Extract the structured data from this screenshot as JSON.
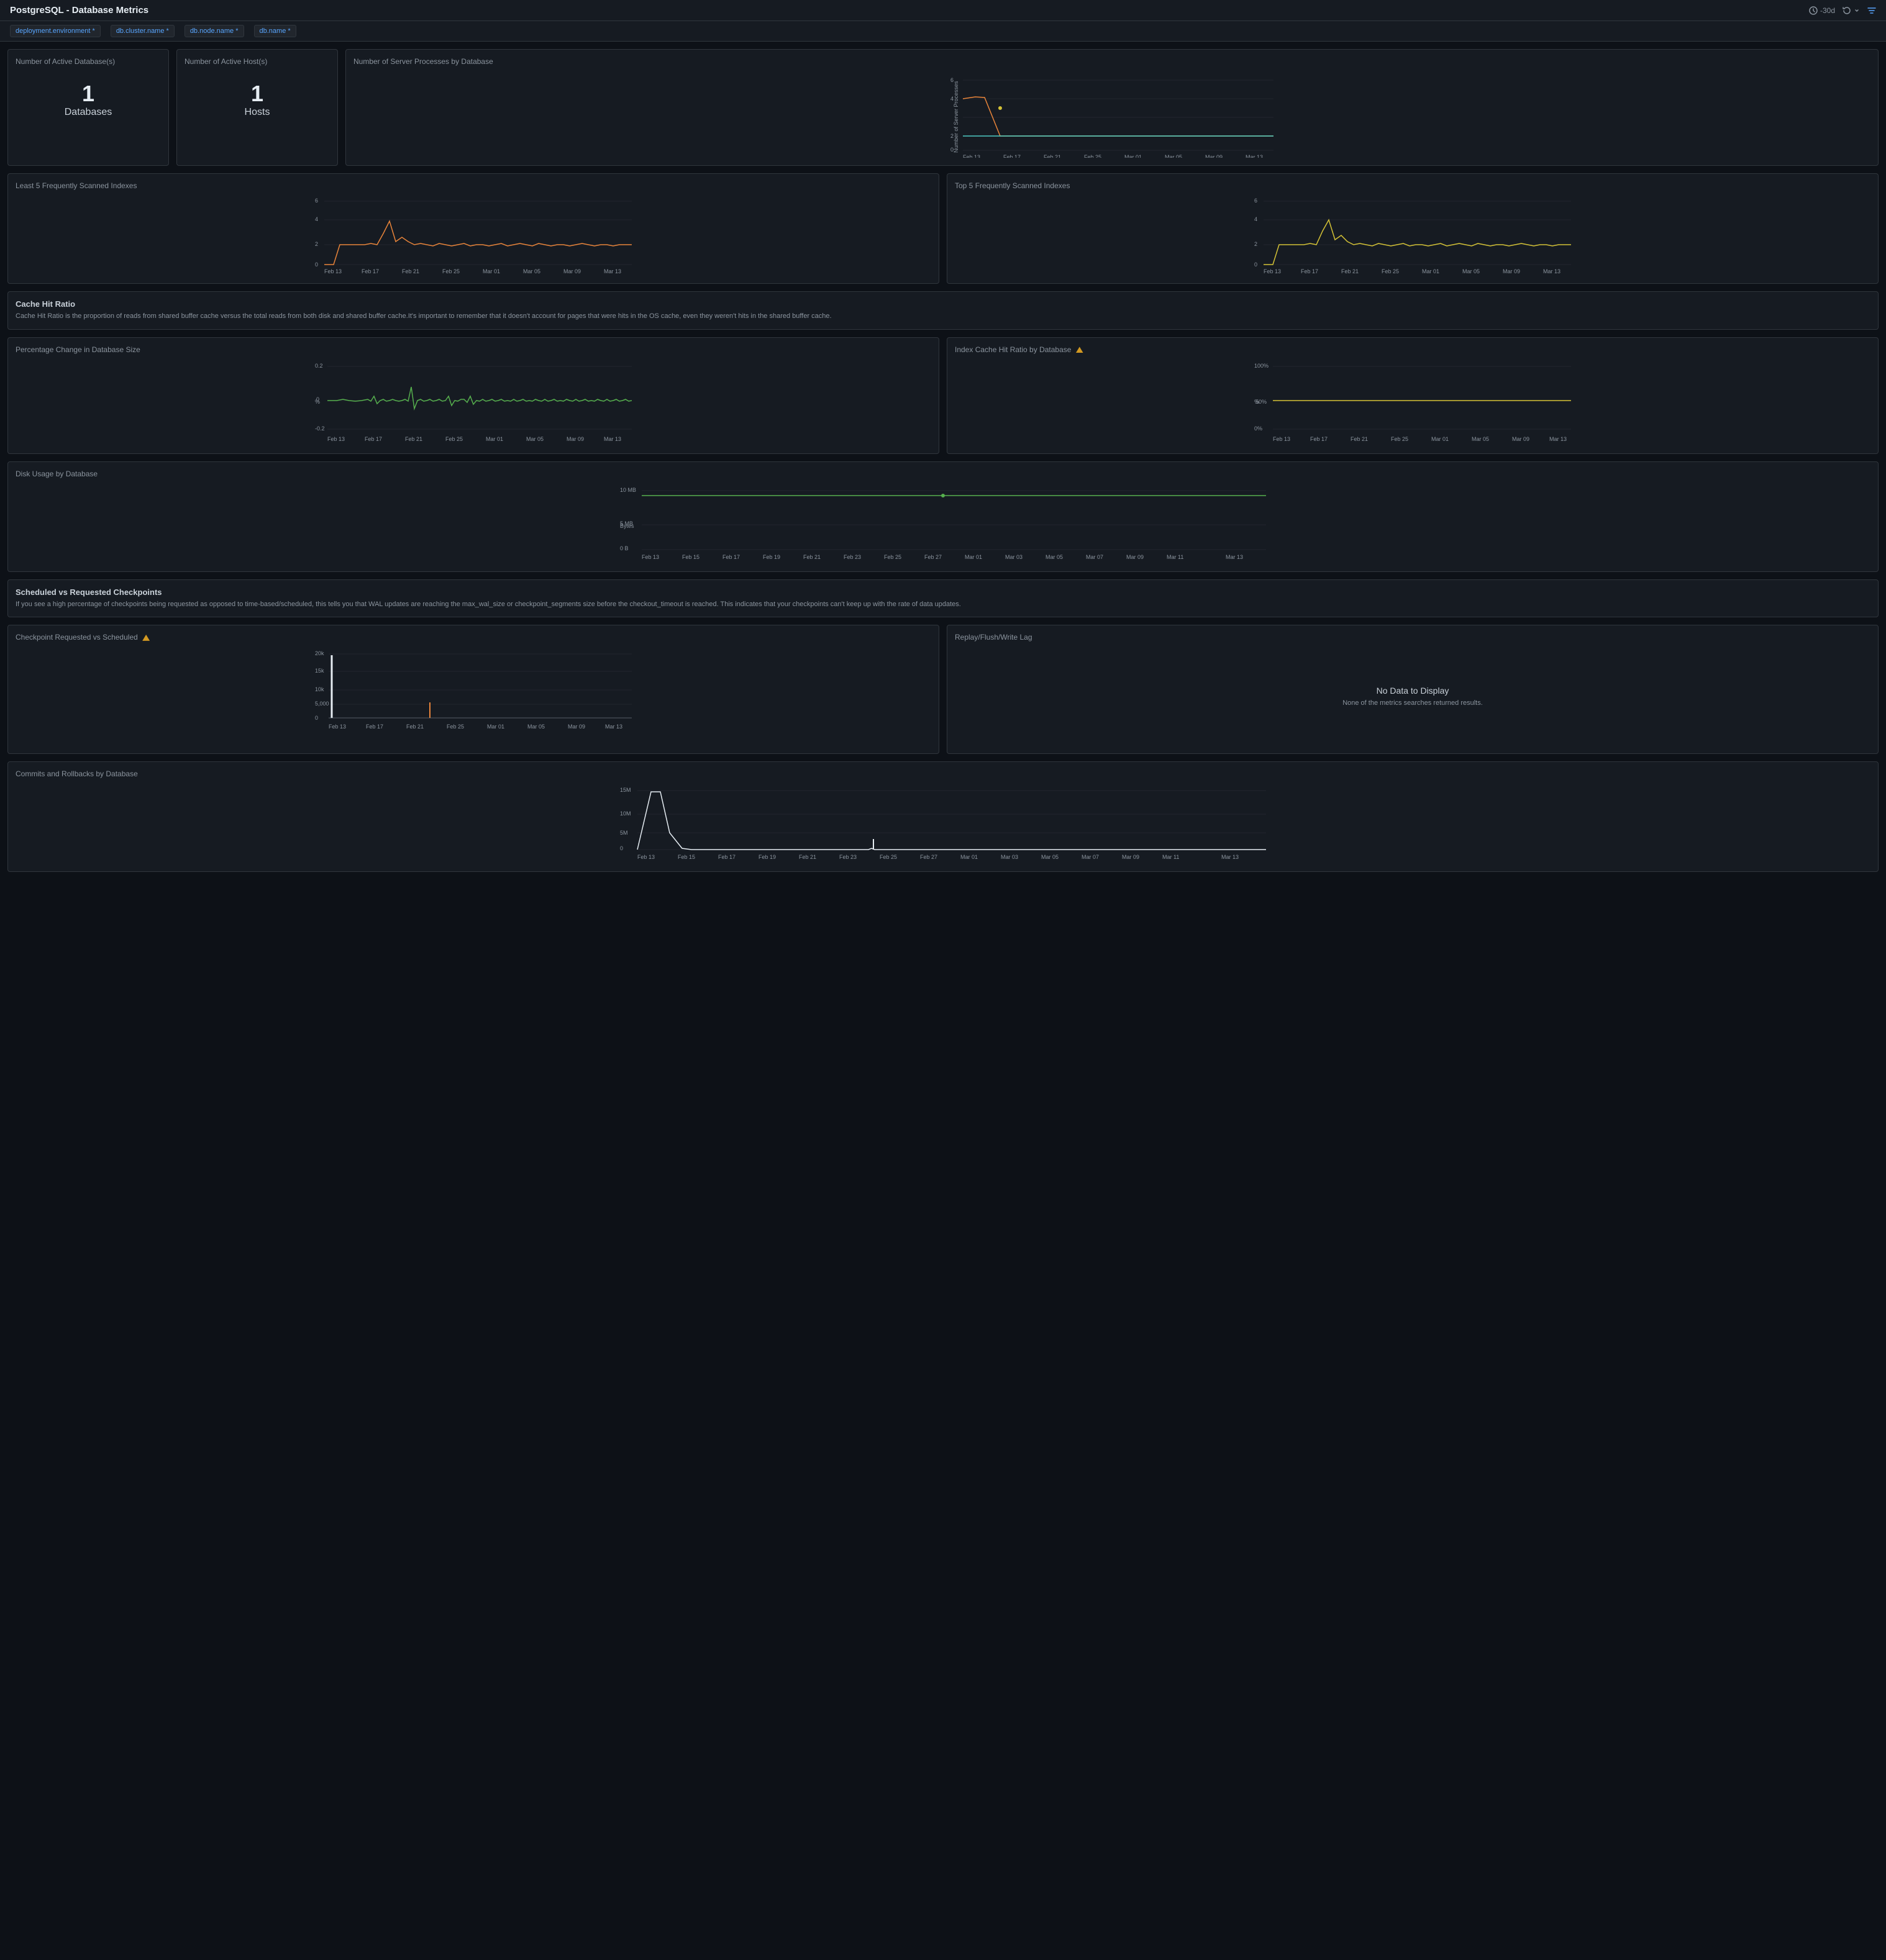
{
  "header": {
    "title": "PostgreSQL - Database Metrics",
    "time_range": "-30d",
    "controls": {
      "time": "-30d",
      "refresh": "↺",
      "filter": "filter"
    }
  },
  "filter_bar": {
    "filters": [
      {
        "label": "deployment.environment",
        "required": true
      },
      {
        "label": "db.cluster.name",
        "required": true
      },
      {
        "label": "db.node.name",
        "required": true
      },
      {
        "label": "db.name",
        "required": true
      }
    ]
  },
  "panels": {
    "active_databases": {
      "title": "Number of Active Database(s)",
      "value": "1",
      "label": "Databases"
    },
    "active_hosts": {
      "title": "Number of Active Host(s)",
      "value": "1",
      "label": "Hosts"
    },
    "server_processes": {
      "title": "Number of Server Processes by Database"
    },
    "least_scanned": {
      "title": "Least 5 Frequently Scanned Indexes"
    },
    "top_scanned": {
      "title": "Top 5 Frequently Scanned Indexes"
    },
    "cache_hit_section": {
      "title": "Cache Hit Ratio",
      "description": "Cache Hit Ratio is the proportion of reads from shared buffer cache versus the total reads from both disk and shared buffer cache.It's important to remember that it doesn't account for pages that were hits in the OS cache, even they weren't hits in the shared buffer cache."
    },
    "pct_change_db": {
      "title": "Percentage Change in Database Size"
    },
    "index_cache_hit": {
      "title": "Index Cache Hit Ratio by Database"
    },
    "disk_usage": {
      "title": "Disk Usage by Database"
    },
    "scheduled_checkpoints_section": {
      "title": "Scheduled vs Requested Checkpoints",
      "description": "If you see a high percentage of checkpoints being requested as opposed to time-based/scheduled, this tells you that WAL updates are reaching the max_wal_size or checkpoint_segments size before the checkout_timeout is reached. This indicates that your checkpoints can't keep up with the rate of data updates."
    },
    "checkpoint_requested": {
      "title": "Checkpoint Requested vs Scheduled"
    },
    "replay_lag": {
      "title": "Replay/Flush/Write Lag",
      "no_data": "No Data to Display",
      "no_data_sub": "None of the metrics searches returned results."
    },
    "commits_rollbacks": {
      "title": "Commits and Rollbacks by Database"
    }
  },
  "x_axis_labels": {
    "standard": [
      "Feb 13",
      "Feb 17",
      "Feb 21",
      "Feb 25",
      "Mar 01",
      "Mar 05",
      "Mar 09",
      "Mar 13"
    ],
    "extended": [
      "Feb 13",
      "Feb 15",
      "Feb 17",
      "Feb 19",
      "Feb 21",
      "Feb 23",
      "Feb 25",
      "Feb 27",
      "Mar 01",
      "Mar 03",
      "Mar 05",
      "Mar 07",
      "Mar 09",
      "Mar 11",
      "Mar 13"
    ]
  },
  "colors": {
    "orange": "#e8843a",
    "green": "#56b04e",
    "yellow": "#d4c236",
    "blue": "#4299e1",
    "purple": "#9b59b6",
    "teal": "#4ecdc4",
    "white": "#e6edf3",
    "grid": "#21262d",
    "bg": "#161b22",
    "border": "#30363d"
  }
}
